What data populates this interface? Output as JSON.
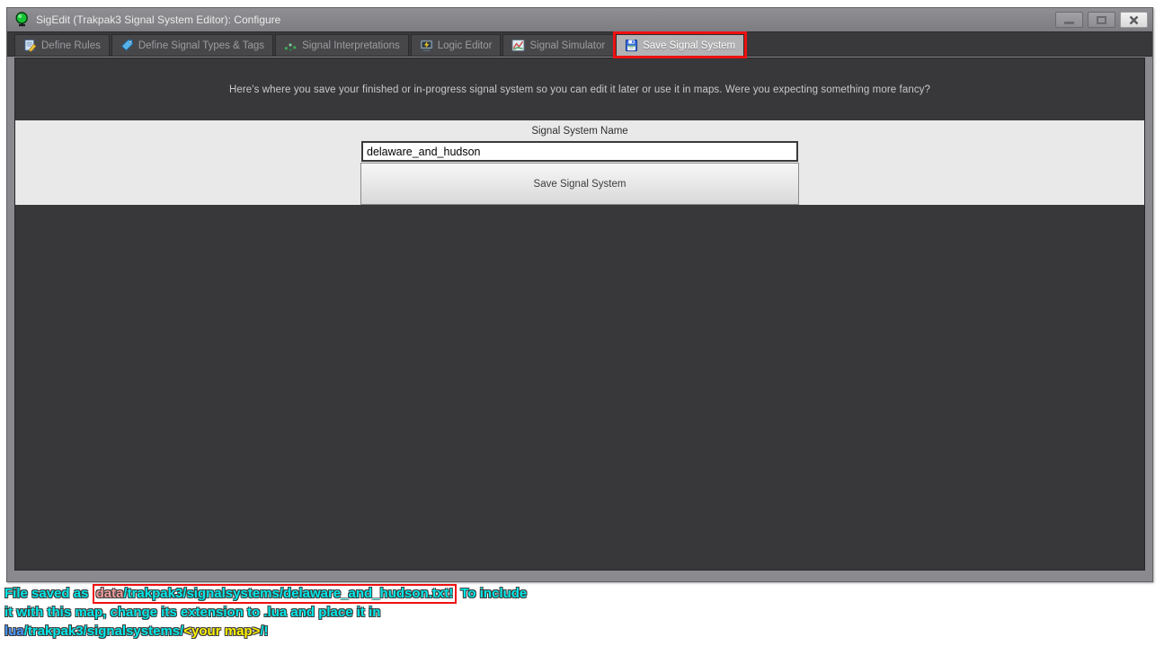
{
  "window": {
    "title": "SigEdit (Trakpak3 Signal System Editor): Configure",
    "icon": "green-signal-lamp-icon",
    "controls": [
      "minimize",
      "maximize",
      "close"
    ]
  },
  "tabs": [
    {
      "label": "Define Rules",
      "icon": "notepad-pencil-icon",
      "active": false
    },
    {
      "label": "Define Signal Types & Tags",
      "icon": "tag-icon",
      "active": false
    },
    {
      "label": "Signal Interpretations",
      "icon": "green-dots-graph-icon",
      "active": false
    },
    {
      "label": "Logic Editor",
      "icon": "monitor-lightning-icon",
      "active": false
    },
    {
      "label": "Signal Simulator",
      "icon": "chart-icon",
      "active": false
    },
    {
      "label": "Save Signal System",
      "icon": "floppy-disk-icon",
      "active": true,
      "annotated": true
    }
  ],
  "content": {
    "message": "Here's where you save your finished or in-progress signal system so you can edit it later or use it in maps. Were you expecting something more fancy?",
    "form": {
      "label": "Signal System Name",
      "input_value": "delaware_and_hudson",
      "button_label": "Save Signal System"
    }
  },
  "console": {
    "line1_prefix": "File saved as ",
    "line1_path_data": "data",
    "line1_path_rest": "/trakpak3/signalsystems/delaware_and_hudson.txt!",
    "line1_suffix": " To include",
    "line2": "it with this map, change its extension to .lua and place it in",
    "line3_lua": "lua",
    "line3_path": "/trakpak3/signalsystems/",
    "line3_map": "<your map>",
    "line3_suffix": "/!"
  },
  "colors": {
    "annotation_red": "#ee1111",
    "console_cyan": "#00e8e8",
    "console_salmon": "#f49a9a",
    "console_blue": "#4896ff",
    "console_yellow": "#fff200",
    "content_dark": "#38383a",
    "band_gray": "#e9e9e9",
    "frame_gray": "#8a8a8e"
  }
}
